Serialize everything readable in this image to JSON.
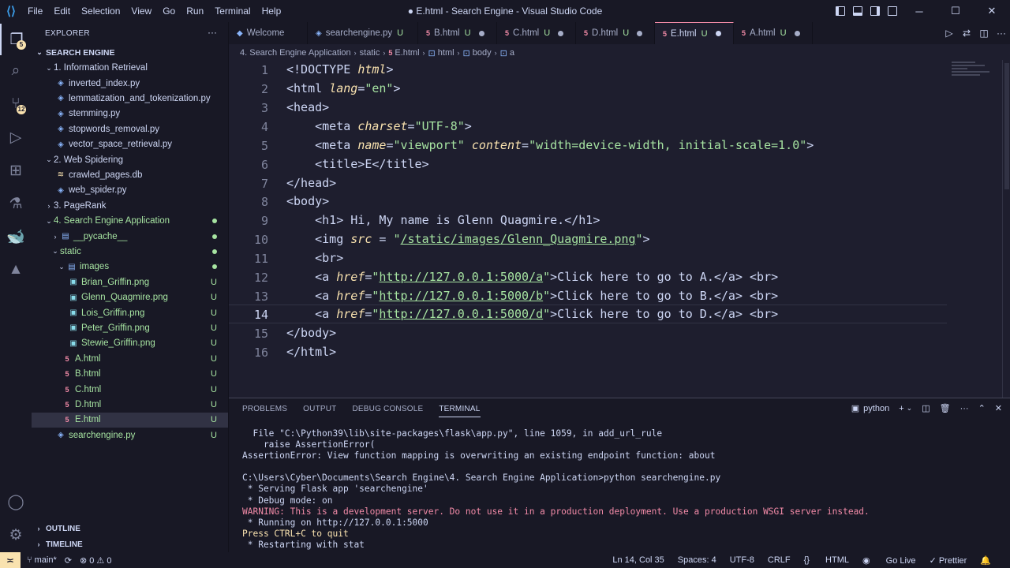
{
  "window": {
    "title": "● E.html - Search Engine - Visual Studio Code",
    "menu": [
      "File",
      "Edit",
      "Selection",
      "View",
      "Go",
      "Run",
      "Terminal",
      "Help"
    ]
  },
  "activity_bar": {
    "scm_badge": "12",
    "explorer_badge": "5"
  },
  "sidebar": {
    "header": "EXPLORER",
    "root": "SEARCH ENGINE",
    "items": [
      {
        "label": "1. Information Retrieval",
        "kind": "folder-open"
      },
      {
        "label": "inverted_index.py",
        "kind": "py"
      },
      {
        "label": "lemmatization_and_tokenization.py",
        "kind": "py"
      },
      {
        "label": "stemming.py",
        "kind": "py"
      },
      {
        "label": "stopwords_removal.py",
        "kind": "py"
      },
      {
        "label": "vector_space_retrieval.py",
        "kind": "py"
      },
      {
        "label": "2. Web Spidering",
        "kind": "folder-open"
      },
      {
        "label": "crawled_pages.db",
        "kind": "db"
      },
      {
        "label": "web_spider.py",
        "kind": "py"
      },
      {
        "label": "3. PageRank",
        "kind": "folder-closed"
      },
      {
        "label": "4. Search Engine Application",
        "kind": "folder-open"
      },
      {
        "label": "__pycache__",
        "kind": "folder-closed"
      },
      {
        "label": "static",
        "kind": "folder-open"
      },
      {
        "label": "images",
        "kind": "folder-open"
      },
      {
        "label": "Brian_Griffin.png",
        "kind": "img",
        "status": "U"
      },
      {
        "label": "Glenn_Quagmire.png",
        "kind": "img",
        "status": "U"
      },
      {
        "label": "Lois_Griffin.png",
        "kind": "img",
        "status": "U"
      },
      {
        "label": "Peter_Griffin.png",
        "kind": "img",
        "status": "U"
      },
      {
        "label": "Stewie_Griffin.png",
        "kind": "img",
        "status": "U"
      },
      {
        "label": "A.html",
        "kind": "html",
        "status": "U"
      },
      {
        "label": "B.html",
        "kind": "html",
        "status": "U"
      },
      {
        "label": "C.html",
        "kind": "html",
        "status": "U"
      },
      {
        "label": "D.html",
        "kind": "html",
        "status": "U"
      },
      {
        "label": "E.html",
        "kind": "html",
        "status": "U"
      },
      {
        "label": "searchengine.py",
        "kind": "py",
        "status": "U"
      }
    ],
    "outline": "OUTLINE",
    "timeline": "TIMELINE"
  },
  "tabs": [
    {
      "label": "Welcome",
      "status": ""
    },
    {
      "label": "searchengine.py",
      "status": "U"
    },
    {
      "label": "B.html",
      "status": "U"
    },
    {
      "label": "C.html",
      "status": "U"
    },
    {
      "label": "D.html",
      "status": "U"
    },
    {
      "label": "E.html",
      "status": "U"
    },
    {
      "label": "A.html",
      "status": "U"
    }
  ],
  "breadcrumb": [
    "4. Search Engine Application",
    "static",
    "E.html",
    "html",
    "body",
    "a"
  ],
  "editor": {
    "line_numbers": [
      "1",
      "2",
      "3",
      "4",
      "5",
      "6",
      "7",
      "8",
      "9",
      "10",
      "11",
      "12",
      "13",
      "14",
      "15",
      "16"
    ],
    "lines": {
      "l1": {
        "t1": "<!DOCTYPE ",
        "a1": "html",
        "t2": ">"
      },
      "l2": {
        "t1": "<html ",
        "a1": "lang",
        "t2": "=",
        "s1": "\"en\"",
        "t3": ">"
      },
      "l3": {
        "t1": "<head>"
      },
      "l4": {
        "t1": "    <meta ",
        "a1": "charset",
        "t2": "=",
        "s1": "\"UTF-8\"",
        "t3": ">"
      },
      "l5": {
        "t1": "    <meta ",
        "a1": "name",
        "t2": "=",
        "s1": "\"viewport\"",
        "t3": " ",
        "a2": "content",
        "t4": "=",
        "s2": "\"width=device-width, initial-scale=1.0\"",
        "t5": ">"
      },
      "l6": {
        "t1": "    <title>E</title>"
      },
      "l7": {
        "t1": "</head>"
      },
      "l8": {
        "t1": "<body>"
      },
      "l9": {
        "t1": "    <h1> Hi, My name is Glenn Quagmire.</h1>"
      },
      "l10": {
        "t1": "    <img ",
        "a1": "src",
        "t2": " = ",
        "s1": "\"",
        "u1": "/static/images/Glenn_Quagmire.png",
        "s2": "\"",
        "t3": ">"
      },
      "l11": {
        "t1": "    <br>"
      },
      "l12": {
        "t1": "    <a ",
        "a1": "href",
        "t2": "=",
        "s1": "\"",
        "u1": "http://127.0.0.1:5000/a",
        "s2": "\"",
        "t3": ">Click here to go to A.</a> <br>"
      },
      "l13": {
        "t1": "    <a ",
        "a1": "href",
        "t2": "=",
        "s1": "\"",
        "u1": "http://127.0.0.1:5000/b",
        "s2": "\"",
        "t3": ">Click here to go to B.</a> <br>"
      },
      "l14": {
        "t1": "    <a ",
        "a1": "href",
        "t2": "=",
        "s1": "\"",
        "u1": "http://127.0.0.1:5000/d",
        "s2": "\"",
        "t3": ">Click here to go to D.</a> <br>"
      },
      "l15": {
        "t1": "</body>"
      },
      "l16": {
        "t1": "</html>"
      }
    }
  },
  "panel": {
    "tabs": [
      "PROBLEMS",
      "OUTPUT",
      "DEBUG CONSOLE",
      "TERMINAL"
    ],
    "shell": "python",
    "terminal": [
      {
        "text": "  File \"C:\\Python39\\lib\\site-packages\\flask\\app.py\", line 1059, in add_url_rule",
        "style": ""
      },
      {
        "text": "    raise AssertionError(",
        "style": ""
      },
      {
        "text": "AssertionError: View function mapping is overwriting an existing endpoint function: about",
        "style": ""
      },
      {
        "text": "",
        "style": ""
      },
      {
        "text": "C:\\Users\\Cyber\\Documents\\Search Engine\\4. Search Engine Application>python searchengine.py",
        "style": ""
      },
      {
        "text": " * Serving Flask app 'searchengine'",
        "style": ""
      },
      {
        "text": " * Debug mode: on",
        "style": ""
      },
      {
        "text": "WARNING: This is a development server. Do not use it in a production deployment. Use a production WSGI server instead.",
        "style": "warn"
      },
      {
        "text": " * Running on http://127.0.0.1:5000",
        "style": ""
      },
      {
        "text": "Press CTRL+C to quit",
        "style": "yellow"
      },
      {
        "text": " * Restarting with stat",
        "style": ""
      }
    ]
  },
  "statusbar": {
    "branch": "main*",
    "sync": "⟳",
    "problems": "⊗ 0 ⚠ 0",
    "position": "Ln 14, Col 35",
    "spaces": "Spaces: 4",
    "encoding": "UTF-8",
    "eol": "CRLF",
    "language": "HTML",
    "golive": "Go Live",
    "prettier": "✓ Prettier"
  }
}
